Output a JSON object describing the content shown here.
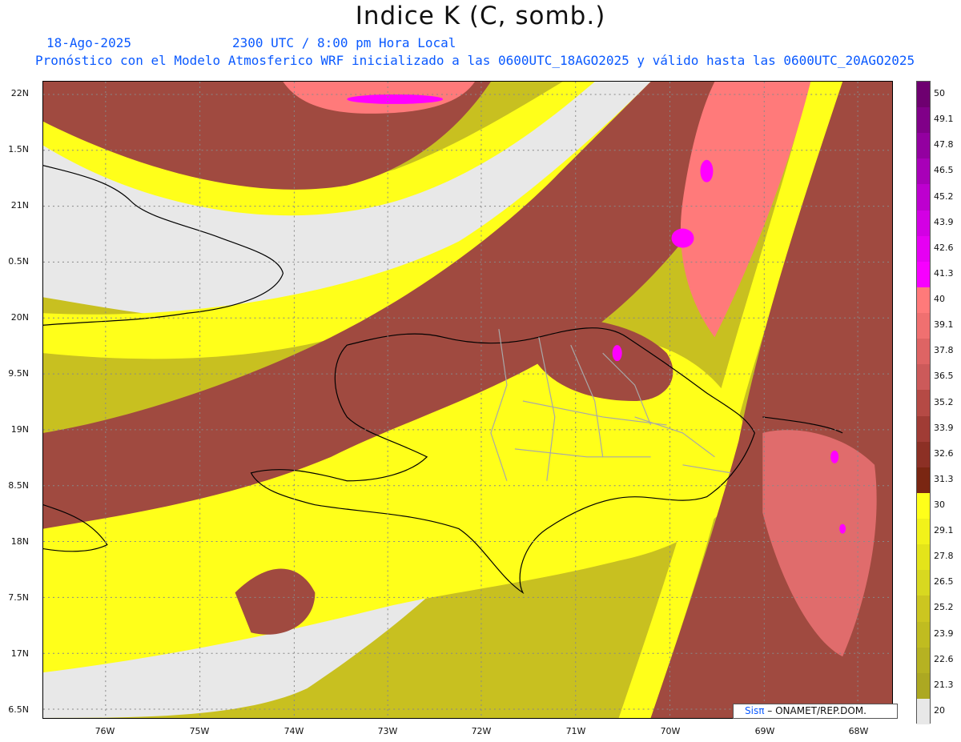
{
  "header": {
    "title": "Indice K (C, somb.)",
    "date": "18-Ago-2025",
    "time": "2300 UTC / 8:00 pm Hora Local",
    "description": "Pronóstico con el Modelo Atmosferico WRF inicializado a las 0600UTC_18AGO2025 y válido hasta las  0600UTC_20AGO2025"
  },
  "axes": {
    "lat_labels": [
      "22N",
      "1.5N",
      "21N",
      "0.5N",
      "20N",
      "9.5N",
      "19N",
      "8.5N",
      "18N",
      "7.5N",
      "17N",
      "6.5N"
    ],
    "lon_labels": [
      "76W",
      "75W",
      "74W",
      "73W",
      "72W",
      "71W",
      "70W",
      "69W",
      "68W"
    ]
  },
  "colorbar": {
    "labels": [
      "50",
      "49.1",
      "47.8",
      "46.5",
      "45.2",
      "43.9",
      "42.6",
      "41.3",
      "40",
      "39.1",
      "37.8",
      "36.5",
      "35.2",
      "33.9",
      "32.6",
      "31.3",
      "30",
      "29.1",
      "27.8",
      "26.5",
      "25.2",
      "23.9",
      "22.6",
      "21.3",
      "20"
    ],
    "colors": [
      "#6e0070",
      "#800088",
      "#9300a0",
      "#a800b8",
      "#bd00cf",
      "#d300e4",
      "#e600f3",
      "#f700ff",
      "#ff7a7a",
      "#f07070",
      "#de6464",
      "#cc5a5a",
      "#b54a45",
      "#a03c35",
      "#8c3025",
      "#7a2612",
      "#ffff1a",
      "#f2f21a",
      "#e4e41a",
      "#d8d820",
      "#ccc620",
      "#c0bc20",
      "#b6b222",
      "#aca822",
      "#e8e8e8"
    ]
  },
  "credit": {
    "sis": "Sisπ",
    "rest": "– ONAMET/REP.DOM."
  },
  "legend_colors": {
    "no_data": "#e8e8e8",
    "low": "#c8c020",
    "mid": "#ffff1a",
    "high": "#a04a40",
    "max": "#ff00ff"
  }
}
